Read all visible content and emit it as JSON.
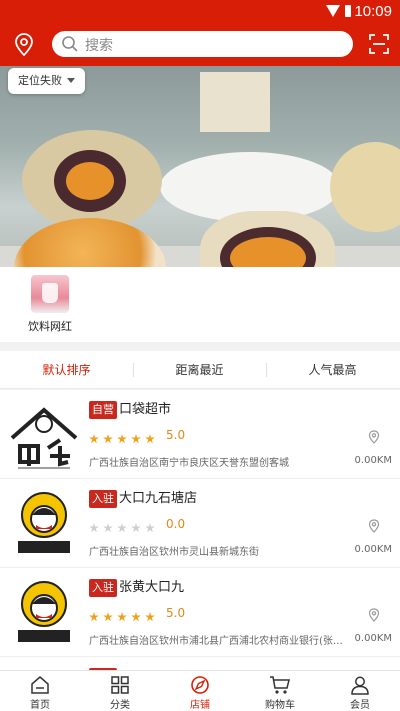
{
  "status": {
    "time": "10:09"
  },
  "search": {
    "placeholder": "搜索"
  },
  "location": {
    "label": "定位失败"
  },
  "categories": [
    {
      "label": "饮料网红"
    }
  ],
  "sort": {
    "default": "默认排序",
    "distance": "距离最近",
    "popular": "人气最高"
  },
  "stores": [
    {
      "badge": "自营",
      "name": "口袋超市",
      "stars": 5,
      "rating": "5.0",
      "address": "广西壮族自治区南宁市良庆区天誉东盟创客城",
      "distance": "0.00KM",
      "logo": "shiguang-logo"
    },
    {
      "badge": "入驻",
      "name": "大口九石塘店",
      "stars": 0,
      "rating": "0.0",
      "address": "广西壮族自治区钦州市灵山县新城东街",
      "distance": "0.00KM",
      "logo": "dakoujiu-logo"
    },
    {
      "badge": "入驻",
      "name": "张黄大口九",
      "stars": 5,
      "rating": "5.0",
      "address": "广西壮族自治区钦州市浦北县广西浦北农村商业银行(张黄...",
      "distance": "0.00KM",
      "logo": "dakoujiu-logo"
    }
  ],
  "tabs": {
    "home": "首页",
    "category": "分类",
    "shop": "店铺",
    "cart": "购物车",
    "member": "会员"
  },
  "colors": {
    "brand": "#d81e06",
    "star": "#f0a11e"
  }
}
